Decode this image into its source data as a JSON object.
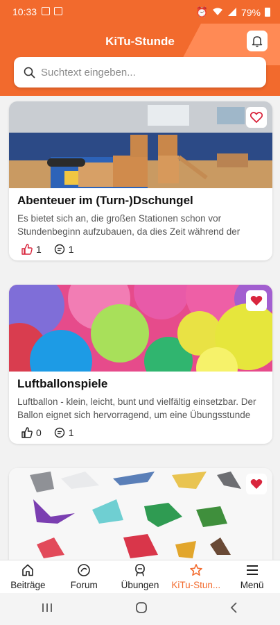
{
  "status": {
    "time": "10:33",
    "battery": "79%"
  },
  "header": {
    "title": "KiTu-Stunde"
  },
  "search": {
    "placeholder": "Suchtext eingeben..."
  },
  "cards": [
    {
      "title": "Abenteuer im (Turn-)Dschungel",
      "text": "Es bietet sich an, die großen Stationen schon vor Stundenbeginn aufzubauen, da dies Zeit während der Übungsstunde einspart. Es ist sowohl möglich, ...",
      "likes": "1",
      "comments": "1",
      "liked": true,
      "favorite": false
    },
    {
      "title": "Luftballonspiele",
      "text": "Luftballon - klein, leicht, bunt und vielfältig einsetzbar. Der Ballon eignet sich hervorragend, um eine Übungsstunde mit Kindern zur Verbesserung ...",
      "likes": "0",
      "comments": "1",
      "liked": false,
      "favorite": true
    },
    {
      "title": "",
      "text": "",
      "favorite": true
    }
  ],
  "nav": [
    {
      "label": "Beiträge",
      "icon": "home-icon"
    },
    {
      "label": "Forum",
      "icon": "forum-icon"
    },
    {
      "label": "Übungen",
      "icon": "exercise-icon"
    },
    {
      "label": "KiTu-Stun...",
      "icon": "star-icon",
      "active": true
    },
    {
      "label": "Menü",
      "icon": "menu-icon"
    }
  ],
  "colors": {
    "accent": "#f26a2d",
    "favorite": "#d9263d"
  }
}
